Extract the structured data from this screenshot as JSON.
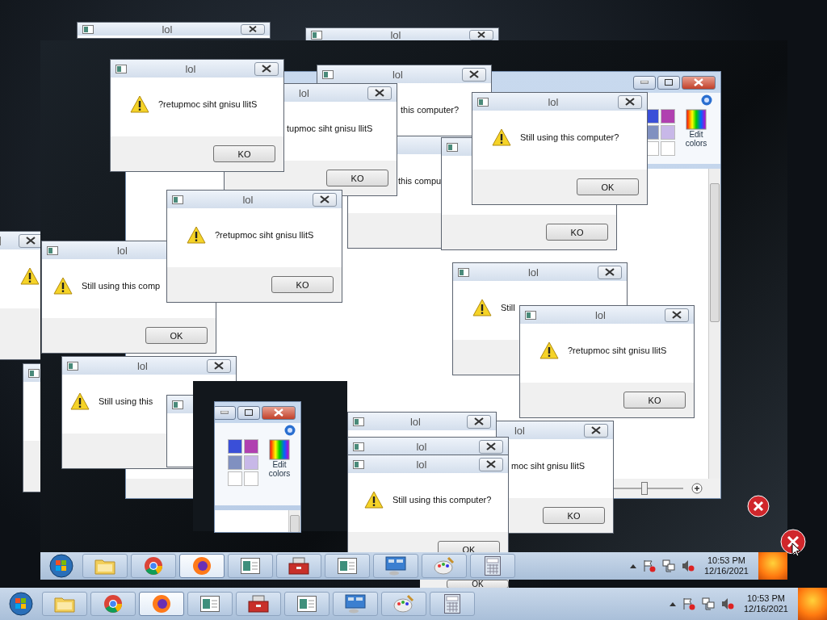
{
  "dialogs": [
    {
      "kind": "message-box",
      "title": "lol"
    },
    {
      "kind": "message-box",
      "title": "lol"
    },
    {
      "kind": "message-box",
      "title": "lol",
      "message": "?retupmoc siht gnisu llitS",
      "button": "KO"
    },
    {
      "kind": "message-box",
      "title": "lol",
      "message": "tupmoc siht gnisu llitS",
      "button": "KO"
    },
    {
      "kind": "message-box",
      "title": "lol",
      "message": "this computer?"
    },
    {
      "kind": "message-box",
      "title": "lol",
      "message": "?retupmoc siht gnisu llitS",
      "button": "KO"
    },
    {
      "kind": "message-box",
      "message": "this compu"
    },
    {
      "kind": "message-box",
      "title": "lol",
      "message": "Still using this computer?",
      "button": "OK"
    },
    {
      "kind": "message-box",
      "button": "KO"
    },
    {
      "kind": "message-box"
    },
    {
      "kind": "message-box",
      "title": "lol",
      "message": "Still using this comp",
      "button": "OK"
    },
    {
      "kind": "message-box"
    },
    {
      "kind": "message-box",
      "title": "lol",
      "message": "Still using this"
    },
    {
      "kind": "message-box"
    },
    {
      "kind": "message-box",
      "title": "lol"
    },
    {
      "kind": "message-box",
      "title": "lol",
      "message": "Still"
    },
    {
      "kind": "message-box",
      "title": "lol",
      "message": "?retupmoc siht gnisu llitS",
      "button": "KO"
    },
    {
      "kind": "message-box",
      "title": "lol"
    },
    {
      "kind": "message-box",
      "title": "lol",
      "message": "Still using this computer?",
      "button": "OK"
    },
    {
      "kind": "message-box",
      "title": "lol",
      "message": "moc siht gnisu llitS",
      "button": "KO"
    }
  ],
  "paint_windows": [
    {
      "edit_colors": "Edit colors",
      "zoom": {
        "level": 0.45
      }
    },
    {
      "edit_colors": "Edit colors"
    }
  ],
  "fragment_button": "OK",
  "taskbars": [
    {
      "apps": [
        {
          "kind": "folder",
          "selected": false
        },
        {
          "kind": "chrome",
          "selected": false
        },
        {
          "kind": "firefox",
          "selected": true
        },
        {
          "kind": "window",
          "selected": false
        },
        {
          "kind": "toolbox",
          "selected": false
        },
        {
          "kind": "window",
          "selected": false
        },
        {
          "kind": "monitor",
          "selected": false
        },
        {
          "kind": "paint",
          "selected": false
        },
        {
          "kind": "calculator",
          "selected": false
        }
      ],
      "time": "10:53 PM",
      "date": "12/16/2021"
    },
    {
      "apps": [
        {
          "kind": "folder",
          "selected": false
        },
        {
          "kind": "chrome",
          "selected": false
        },
        {
          "kind": "firefox",
          "selected": true
        },
        {
          "kind": "window",
          "selected": false
        },
        {
          "kind": "toolbox",
          "selected": false
        },
        {
          "kind": "window",
          "selected": false
        },
        {
          "kind": "monitor",
          "selected": false
        },
        {
          "kind": "paint",
          "selected": false
        },
        {
          "kind": "calculator",
          "selected": false
        }
      ],
      "time": "10:53 PM",
      "date": "12/16/2021"
    }
  ]
}
